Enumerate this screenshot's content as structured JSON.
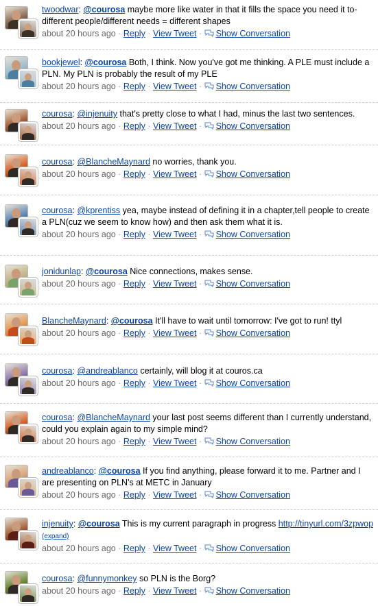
{
  "meta": {
    "time": "about 20 hours ago",
    "reply": "Reply",
    "view_tweet": "View Tweet",
    "show_conversation": "Show Conversation"
  },
  "tweets": [
    {
      "user": "twoodwar",
      "colon": ": ",
      "mention": "@courosa",
      "mention_bold": true,
      "text": " maybe more like water in that it fills the space you need it to- different people/different needs = different shapes",
      "avatar": [
        "#3b3124",
        "#8a6a55"
      ]
    },
    {
      "user": "bookjewel",
      "colon": ": ",
      "mention": "@courosa",
      "mention_bold": true,
      "text": " Both, I think. Now you've got me thinking. A PLE must include a PLN. My PLN is probably the result of my PLE",
      "avatar": [
        "#4c7f9f",
        "#9dbdcc"
      ]
    },
    {
      "user": "courosa",
      "colon": ": ",
      "mention": "@injenuity",
      "mention_bold": false,
      "text": " that's pretty close to what I had, minus the last two sentences.",
      "avatar": [
        "#2f2a25",
        "#a5633a"
      ]
    },
    {
      "user": "courosa",
      "colon": ": ",
      "mention": "@BlancheMaynard",
      "mention_bold": false,
      "text": " no worries, thank you.",
      "avatar": [
        "#2f2a25",
        "#d8662c"
      ]
    },
    {
      "user": "courosa",
      "colon": ": ",
      "mention": "@kprentiss",
      "mention_bold": false,
      "text": " yea, maybe instead of defining it in a chapter,tell people to create a PLN(cuz we seem to know how) and then ask them what it is.",
      "avatar": [
        "#2f2a25",
        "#5e88b4"
      ]
    },
    {
      "user": "jonidunlap",
      "colon": ": ",
      "mention": "@courosa",
      "mention_bold": true,
      "text": " Nice connections, makes sense.",
      "avatar": [
        "#7aa36b",
        "#c2b58a"
      ]
    },
    {
      "user": "BlancheMaynard",
      "colon": ": ",
      "mention": "@courosa",
      "mention_bold": true,
      "text": " It'll have to wait until tomorrow: I've got to run! ttyl",
      "avatar": [
        "#c24a1c",
        "#e39a55"
      ]
    },
    {
      "user": "courosa",
      "colon": ": ",
      "mention": "@andreablanco",
      "mention_bold": false,
      "text": " certainly, will blog it at couros.ca",
      "avatar": [
        "#2f2a25",
        "#8e7bb0"
      ]
    },
    {
      "user": "courosa",
      "colon": ": ",
      "mention": "@BlancheMaynard",
      "mention_bold": false,
      "text": " your last post seems different than I currently understand, could you explain again to my simple mind?",
      "avatar": [
        "#2f2a25",
        "#d8662c"
      ]
    },
    {
      "user": "andreablanco",
      "colon": ": ",
      "mention": "@courosa",
      "mention_bold": true,
      "text": " If you find anything, please forward it to me. Partner and I are presenting on PLN's at METC in January",
      "avatar": [
        "#6a5a9a",
        "#d8a67a"
      ]
    },
    {
      "user": "injenuity",
      "colon": ": ",
      "mention": "@courosa",
      "mention_bold": true,
      "text": " This is my current paragraph in progress ",
      "link": "http://tinyurl.com/3zpwop",
      "expand": "(expand)",
      "avatar": [
        "#5a1e14",
        "#a5633a"
      ]
    },
    {
      "user": "courosa",
      "colon": ": ",
      "mention": "@funnymonkey",
      "mention_bold": false,
      "text": " so PLN is the Borg?",
      "avatar": [
        "#2f2a25",
        "#6a8a3a"
      ]
    }
  ]
}
